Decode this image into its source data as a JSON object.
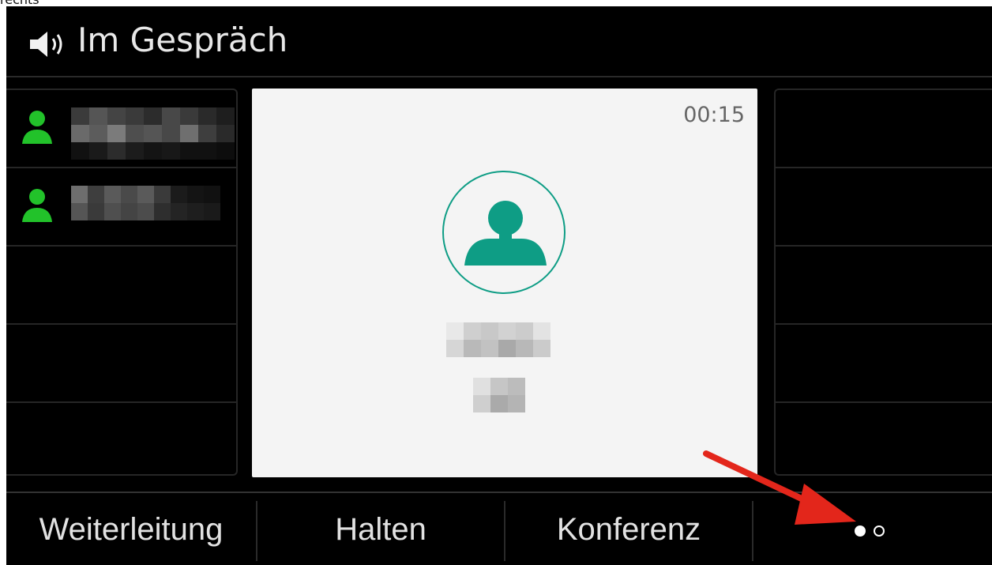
{
  "top_fragment": "rechts",
  "header": {
    "title": "Im Gespräch",
    "icon": "speaker-icon"
  },
  "call": {
    "timer": "00:15",
    "avatar_icon": "person-icon"
  },
  "lines_left": [
    {
      "icon": "person-icon",
      "status_color": "#22c22a"
    },
    {
      "icon": "person-icon",
      "status_color": "#22c22a"
    }
  ],
  "softkeys": [
    {
      "label": "Weiterleitung"
    },
    {
      "label": "Halten"
    },
    {
      "label": "Konferenz"
    }
  ],
  "pager": {
    "current_page": 1,
    "total_pages": 2
  },
  "colors": {
    "accent": "#0e9d85",
    "status_green": "#22c22a",
    "arrow_red": "#e3261b"
  }
}
